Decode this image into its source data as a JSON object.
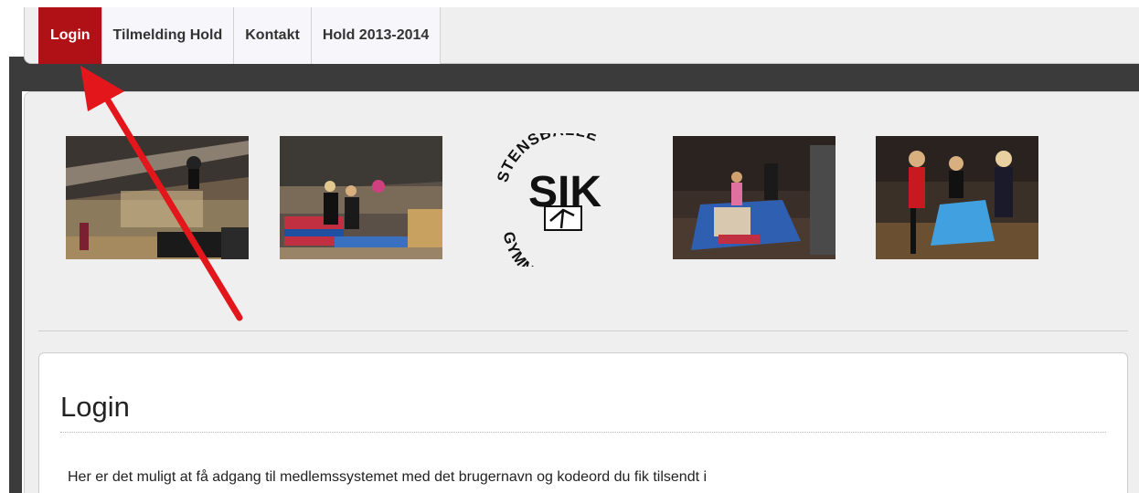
{
  "nav": {
    "tabs": [
      {
        "label": "Login",
        "active": true
      },
      {
        "label": "Tilmelding Hold",
        "active": false
      },
      {
        "label": "Kontakt",
        "active": false
      },
      {
        "label": "Hold 2013-2014",
        "active": false
      }
    ]
  },
  "banner": {
    "photos": [
      {
        "name": "gym-hall-photo"
      },
      {
        "name": "trampoline-photo"
      },
      {
        "name": "gym-floor-photo"
      },
      {
        "name": "kids-vault-photo"
      }
    ],
    "logo": {
      "top_text": "STENSBALLE",
      "center_text": "SIK",
      "bottom_text": "GYMNASTIK"
    }
  },
  "content": {
    "title": "Login",
    "text": "Her er det muligt at få adgang til medlemssystemet med det brugernavn og kodeord du fik tilsendt i"
  },
  "colors": {
    "accent": "#b01116",
    "annotation_arrow": "#e3161b",
    "dark_band": "#3b3b3b"
  }
}
